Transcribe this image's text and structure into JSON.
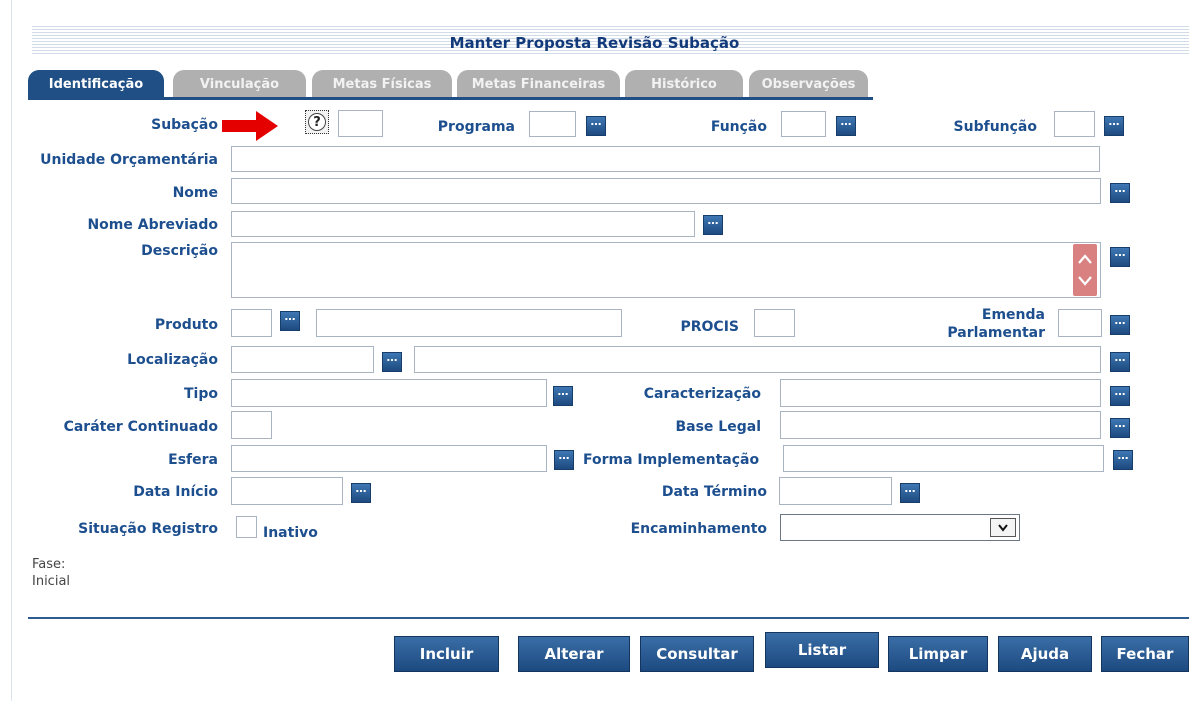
{
  "title": "Manter Proposta Revisão Subação",
  "tabs": [
    "Identificação",
    "Vinculação",
    "Metas Físicas",
    "Metas Financeiras",
    "Histórico",
    "Observações"
  ],
  "active_tab": "Identificação",
  "labels": {
    "subacao": "Subação",
    "programa": "Programa",
    "funcao": "Função",
    "subfuncao": "Subfunção",
    "unidade": "Unidade Orçamentária",
    "nome": "Nome",
    "nome_abreviado": "Nome Abreviado",
    "descricao": "Descrição",
    "produto": "Produto",
    "procis": "PROCIS",
    "emenda_line1": "Emenda",
    "emenda_line2": "Parlamentar",
    "localizacao": "Localização",
    "tipo": "Tipo",
    "caracterizacao": "Caracterização",
    "carater": "Caráter Continuado",
    "base_legal": "Base Legal",
    "esfera": "Esfera",
    "forma": "Forma Implementação",
    "data_inicio": "Data Início",
    "data_termino": "Data Término",
    "situacao": "Situação Registro",
    "inativo": "Inativo",
    "encaminhamento": "Encaminhamento"
  },
  "icons": {
    "lookup": "…",
    "help": "?",
    "dropdown": "⌄"
  },
  "fase": {
    "label": "Fase:",
    "value": "Inicial"
  },
  "buttons": {
    "incluir": "Incluir",
    "alterar": "Alterar",
    "consultar": "Consultar",
    "listar": "Listar",
    "limpar": "Limpar",
    "ajuda": "Ajuda",
    "fechar": "Fechar"
  },
  "colors": {
    "label": "#1d4f8f",
    "tab_active": "#1f4f84",
    "tab_inactive": "#b0b0b0",
    "arrow": "#e50000"
  }
}
